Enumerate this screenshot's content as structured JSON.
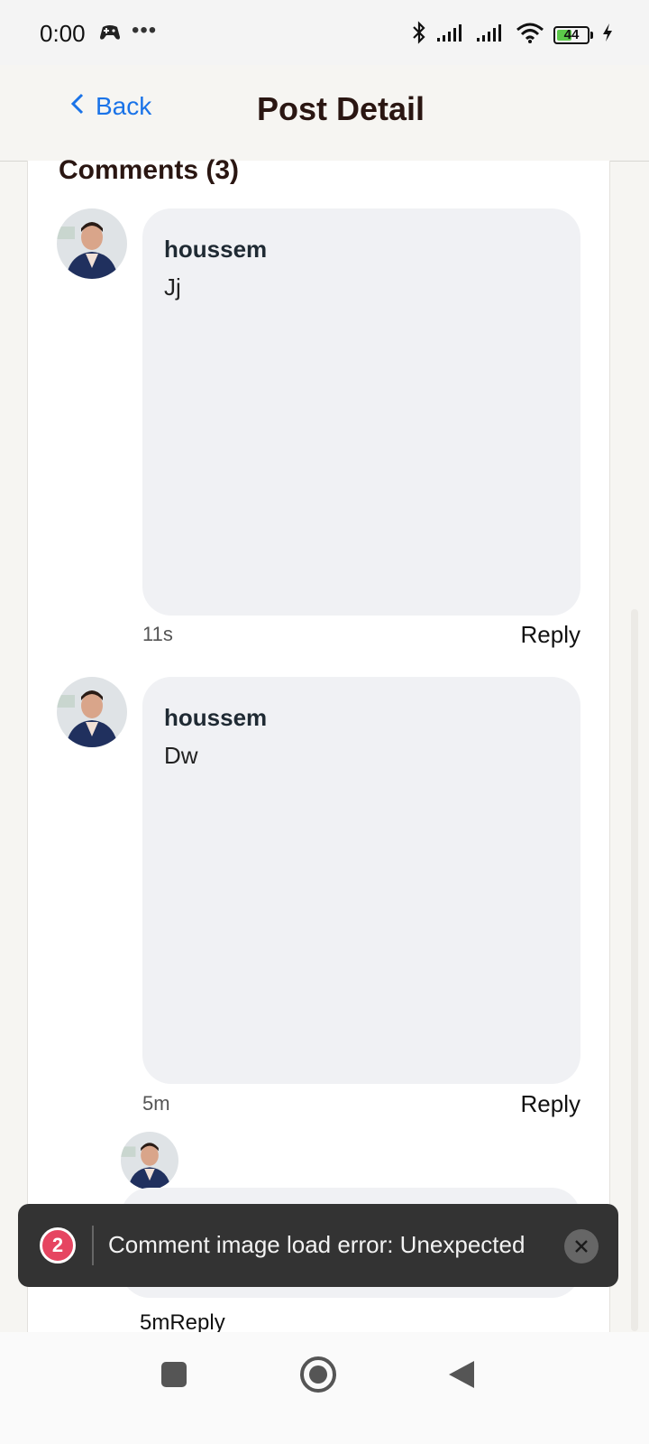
{
  "status": {
    "time": "0:00",
    "dots": "•••",
    "battery": "44"
  },
  "header": {
    "back_label": "Back",
    "title": "Post Detail"
  },
  "comments": {
    "title": "Comments (3)",
    "items": [
      {
        "author": "houssem",
        "text": "Jj",
        "time": "11s",
        "reply_label": "Reply"
      },
      {
        "author": "houssem",
        "text": "Dw",
        "time": "5m",
        "reply_label": "Reply"
      },
      {
        "author": "",
        "text": "",
        "time": "5m",
        "reply_label": "Reply"
      }
    ]
  },
  "toast": {
    "count": "2",
    "message": "Comment image load error: Unexpected"
  },
  "colors": {
    "accent": "#1a73e8",
    "bubble": "#f0f1f4",
    "toast_bg": "#333333",
    "badge": "#e64561"
  },
  "icons": [
    "game-controller-icon",
    "bluetooth-icon",
    "signal-icon",
    "wifi-icon",
    "battery-icon",
    "charging-icon",
    "chevron-left-icon",
    "close-icon",
    "nav-square-icon",
    "nav-home-icon",
    "nav-back-icon"
  ]
}
